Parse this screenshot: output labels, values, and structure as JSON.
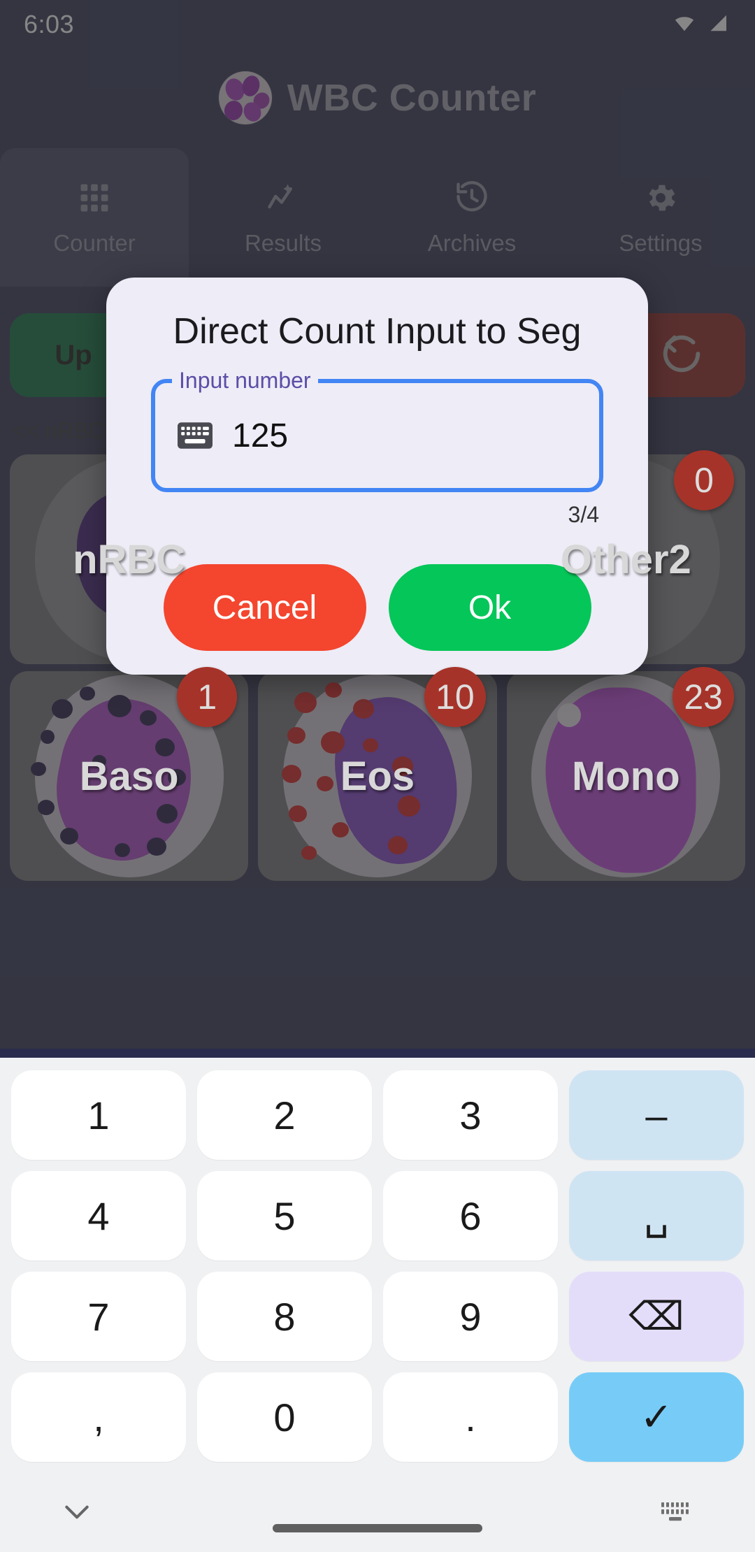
{
  "status_bar": {
    "time": "6:03",
    "icons": [
      "wifi-icon",
      "cellular-signal-icon"
    ]
  },
  "app": {
    "title": "WBC Counter",
    "logo_icon": "wbc-cell-logo-icon"
  },
  "tabs": [
    {
      "label": "Counter",
      "icon": "grid-icon",
      "active": true
    },
    {
      "label": "Results",
      "icon": "analytics-icon",
      "active": false
    },
    {
      "label": "Archives",
      "icon": "history-icon",
      "active": false
    },
    {
      "label": "Settings",
      "icon": "gear-icon",
      "active": false
    }
  ],
  "counter_board": {
    "up_button": "Up",
    "reset_button_icon": "undo-rotate-icon",
    "nrbc_note": "<< nRBC",
    "row1": [
      {
        "label": "nRBC",
        "count": ""
      },
      {
        "label": "",
        "count": ""
      },
      {
        "label": "Other2",
        "count": "0"
      }
    ],
    "row2": [
      {
        "label": "Baso",
        "count": "1"
      },
      {
        "label": "Eos",
        "count": "10"
      },
      {
        "label": "Mono",
        "count": "23"
      }
    ]
  },
  "dialog": {
    "title": "Direct Count Input to Seg",
    "field_label": "Input number",
    "field_value": "125",
    "field_icon": "keyboard-icon",
    "char_counter": "3/4",
    "cancel_label": "Cancel",
    "ok_label": "Ok"
  },
  "keyboard": {
    "keys": [
      {
        "label": "1",
        "name": "key-1",
        "style": ""
      },
      {
        "label": "2",
        "name": "key-2",
        "style": ""
      },
      {
        "label": "3",
        "name": "key-3",
        "style": ""
      },
      {
        "label": "–",
        "name": "key-minus",
        "style": "func-blue"
      },
      {
        "label": "4",
        "name": "key-4",
        "style": ""
      },
      {
        "label": "5",
        "name": "key-5",
        "style": ""
      },
      {
        "label": "6",
        "name": "key-6",
        "style": ""
      },
      {
        "label": "␣",
        "name": "key-space",
        "style": "func-blue"
      },
      {
        "label": "7",
        "name": "key-7",
        "style": ""
      },
      {
        "label": "8",
        "name": "key-8",
        "style": ""
      },
      {
        "label": "9",
        "name": "key-9",
        "style": ""
      },
      {
        "label": "⌫",
        "name": "key-backspace",
        "style": "func-purple"
      },
      {
        "label": ",",
        "name": "key-comma",
        "style": ""
      },
      {
        "label": "0",
        "name": "key-0",
        "style": ""
      },
      {
        "label": ".",
        "name": "key-period",
        "style": ""
      },
      {
        "label": "✓",
        "name": "key-enter",
        "style": "func-enter"
      }
    ],
    "hide_keyboard_icon": "chevron-down-icon",
    "switch_keyboard_icon": "keyboard-switch-icon"
  },
  "colors": {
    "app_bg": "#2a2c4e",
    "dialog_bg": "#eeecf6",
    "accent_blue": "#4285f4",
    "cancel_red": "#f4452e",
    "ok_green": "#05c659",
    "badge_red": "#a63329",
    "up_green": "#046938",
    "reset_red": "#8b1f1c"
  }
}
